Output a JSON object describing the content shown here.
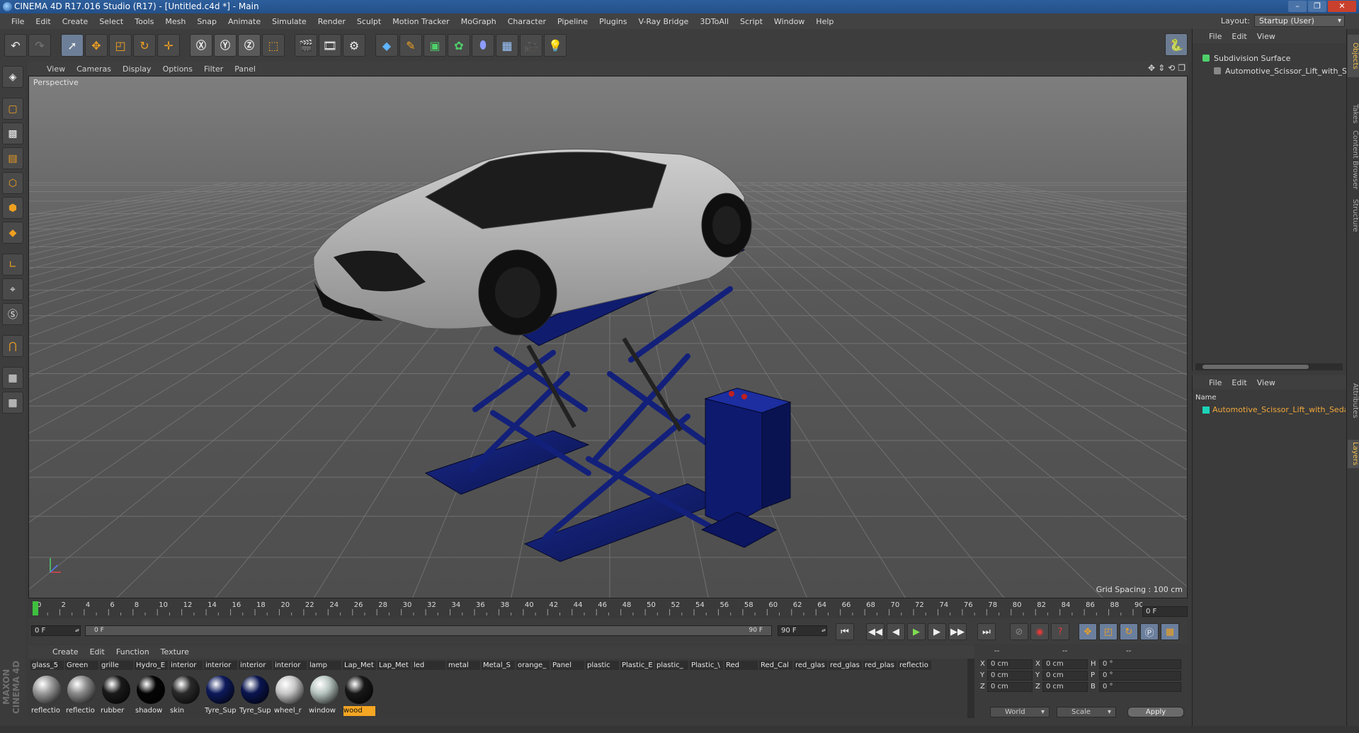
{
  "window": {
    "title": "CINEMA 4D R17.016 Studio (R17) - [Untitled.c4d *] - Main"
  },
  "menu": [
    "File",
    "Edit",
    "Create",
    "Select",
    "Tools",
    "Mesh",
    "Snap",
    "Animate",
    "Simulate",
    "Render",
    "Sculpt",
    "Motion Tracker",
    "MoGraph",
    "Character",
    "Pipeline",
    "Plugins",
    "V-Ray Bridge",
    "3DToAll",
    "Script",
    "Window",
    "Help"
  ],
  "layout": {
    "label": "Layout:",
    "value": "Startup (User)"
  },
  "viewport": {
    "menu": [
      "View",
      "Cameras",
      "Display",
      "Options",
      "Filter",
      "Panel"
    ],
    "label": "Perspective",
    "grid_spacing": "Grid Spacing : 100 cm"
  },
  "timeline": {
    "ticks": [
      "0",
      "2",
      "4",
      "6",
      "8",
      "10",
      "12",
      "14",
      "16",
      "18",
      "20",
      "22",
      "24",
      "26",
      "28",
      "30",
      "32",
      "34",
      "36",
      "38",
      "40",
      "42",
      "44",
      "46",
      "48",
      "50",
      "52",
      "54",
      "56",
      "58",
      "60",
      "62",
      "64",
      "66",
      "68",
      "70",
      "72",
      "74",
      "76",
      "78",
      "80",
      "82",
      "84",
      "86",
      "88",
      "90"
    ],
    "end_frame": "0 F",
    "current_frame": "0 F",
    "range_start": "0 F",
    "range_end_inner": "90 F",
    "range_end": "90 F"
  },
  "materials": {
    "menu": [
      "Create",
      "Edit",
      "Function",
      "Texture"
    ],
    "top_row": [
      "glass_5",
      "Green",
      "grille",
      "Hydro_E",
      "interior",
      "interior",
      "interior",
      "interior",
      "lamp",
      "Lap_Met",
      "Lap_Met",
      "led",
      "metal",
      "Metal_S",
      "orange_",
      "Panel",
      "plastic",
      "Plastic_E",
      "plastic_",
      "Plastic_\\",
      "Red",
      "Red_Cal",
      "red_glas",
      "red_glas",
      "red_plas",
      "reflectio"
    ],
    "bottom_row": [
      {
        "name": "reflectio",
        "color": "#9a9a9a"
      },
      {
        "name": "reflectio",
        "color": "#8c8c8c"
      },
      {
        "name": "rubber",
        "color": "#1a1a1a"
      },
      {
        "name": "shadow",
        "color": "#050505"
      },
      {
        "name": "skin",
        "color": "#2a2a2a"
      },
      {
        "name": "Tyre_Sup",
        "color": "#0d1a5c"
      },
      {
        "name": "Tyre_Sup",
        "color": "#0a1550"
      },
      {
        "name": "wheel_r",
        "color": "#c8c8c8"
      },
      {
        "name": "window",
        "color": "#b8c6c2"
      },
      {
        "name": "wood",
        "color": "#181818",
        "selected": true
      }
    ]
  },
  "coords": {
    "rows": [
      {
        "a": "X",
        "av": "0 cm",
        "b": "X",
        "bv": "0 cm",
        "c": "H",
        "cv": "0 °"
      },
      {
        "a": "Y",
        "av": "0 cm",
        "b": "Y",
        "bv": "0 cm",
        "c": "P",
        "cv": "0 °"
      },
      {
        "a": "Z",
        "av": "0 cm",
        "b": "Z",
        "bv": "0 cm",
        "c": "B",
        "cv": "0 °"
      }
    ],
    "world": "World",
    "scale": "Scale",
    "apply": "Apply",
    "col_headers": [
      "--",
      "--",
      "--"
    ]
  },
  "objects": {
    "menu": [
      "File",
      "Edit",
      "View"
    ],
    "items": [
      "Subdivision Surface",
      "Automotive_Scissor_Lift_with_Sedan"
    ]
  },
  "layers": {
    "menu": [
      "File",
      "Edit",
      "View"
    ],
    "header": "Name",
    "item": "Automotive_Scissor_Lift_with_Sedan"
  },
  "side_tabs": [
    "Objects",
    "Takes",
    "Content Browser",
    "Structure",
    "Attributes",
    "Layers"
  ],
  "brand": "MAXON CINEMA 4D",
  "colors": {
    "accent": "#f5a623",
    "lift": "#0e1a66",
    "layer": "#1bd3b6"
  }
}
